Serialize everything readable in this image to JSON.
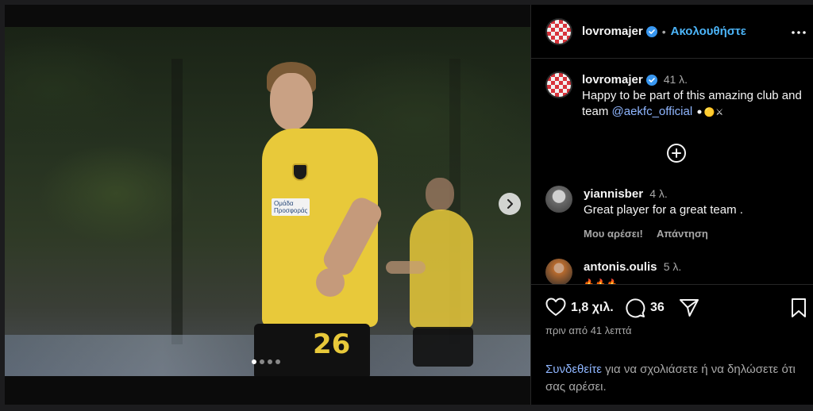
{
  "post": {
    "username": "lovromajer",
    "separator": "•",
    "follow_label": "Ακολουθήστε",
    "caption": {
      "username": "lovromajer",
      "time": "41 λ.",
      "text": "Happy to be part of this amazing club and team ",
      "mention": "@aekfc_official",
      "emojis": "⚫🟡⚔"
    },
    "photo": {
      "jersey_number": "26",
      "sponsor_text": "Ομάδα Προσφοράς",
      "carousel_count": 4,
      "carousel_active": 1
    }
  },
  "comments": [
    {
      "username": "yiannisber",
      "time": "4 λ.",
      "text": "Great player for a great team .",
      "like_label": "Μου αρέσει!",
      "reply_label": "Απάντηση"
    },
    {
      "username": "antonis.oulis",
      "time": "5 λ.",
      "text": "🔥🔥🔥"
    }
  ],
  "stats": {
    "likes": "1,8 χιλ.",
    "comments": "36",
    "posted_ago": "πριν από 41 λεπτά"
  },
  "login_prompt": {
    "link": "Συνδεθείτε",
    "rest": " για να σχολιάσετε ή να δηλώσετε ότι σας αρέσει."
  },
  "colors": {
    "accent": "#4cb5f9",
    "verified": "#3897f0",
    "jersey": "#e8c93a"
  }
}
